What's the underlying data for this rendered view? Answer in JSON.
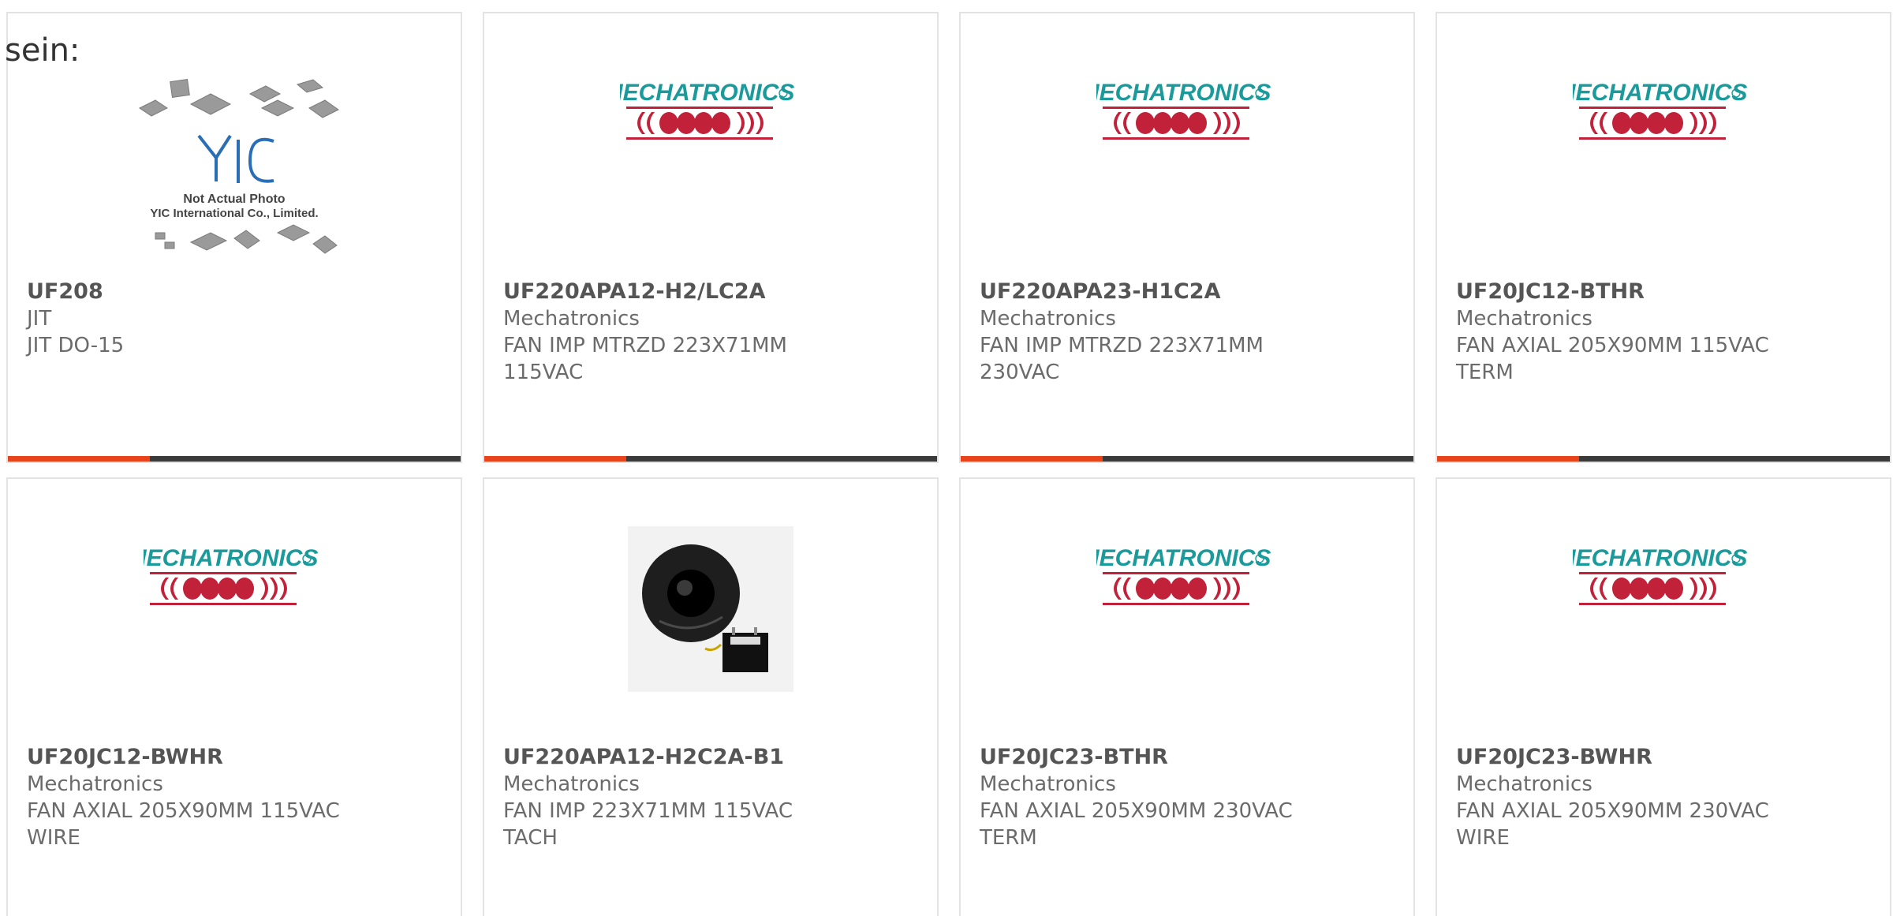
{
  "intro_text": "sein:",
  "colors": {
    "accent": "#e8431a",
    "bar_dark": "#3a3a3a",
    "mechatronics_teal": "#1a9a9a",
    "mechatronics_red": "#c2213a"
  },
  "products": [
    {
      "part_number": "UF208",
      "manufacturer": "JIT",
      "description": "JIT DO-15",
      "image": "yic-not-actual-photo",
      "photo_text_1": "Not Actual Photo",
      "photo_text_2": "YIC International Co., Limited."
    },
    {
      "part_number": "UF220APA12-H2/LC2A",
      "manufacturer": "Mechatronics",
      "description": "FAN IMP MTRZD 223X71MM 115VAC",
      "image": "mechatronics-logo",
      "logo_text": "MECHATRONICS"
    },
    {
      "part_number": "UF220APA23-H1C2A",
      "manufacturer": "Mechatronics",
      "description": "FAN IMP MTRZD 223X71MM 230VAC",
      "image": "mechatronics-logo",
      "logo_text": "MECHATRONICS"
    },
    {
      "part_number": "UF20JC12-BTHR",
      "manufacturer": "Mechatronics",
      "description": "FAN AXIAL 205X90MM 115VAC TERM",
      "image": "mechatronics-logo",
      "logo_text": "MECHATRONICS"
    },
    {
      "part_number": "UF20JC12-BWHR",
      "manufacturer": "Mechatronics",
      "description": "FAN AXIAL 205X90MM 115VAC WIRE",
      "image": "mechatronics-logo",
      "logo_text": "MECHATRONICS"
    },
    {
      "part_number": "UF220APA12-H2C2A-B1",
      "manufacturer": "Mechatronics",
      "description": "FAN IMP 223X71MM 115VAC TACH",
      "image": "impeller-fan-photo"
    },
    {
      "part_number": "UF20JC23-BTHR",
      "manufacturer": "Mechatronics",
      "description": "FAN AXIAL 205X90MM 230VAC TERM",
      "image": "mechatronics-logo",
      "logo_text": "MECHATRONICS"
    },
    {
      "part_number": "UF20JC23-BWHR",
      "manufacturer": "Mechatronics",
      "description": "FAN AXIAL 205X90MM 230VAC WIRE",
      "image": "mechatronics-logo",
      "logo_text": "MECHATRONICS"
    }
  ]
}
